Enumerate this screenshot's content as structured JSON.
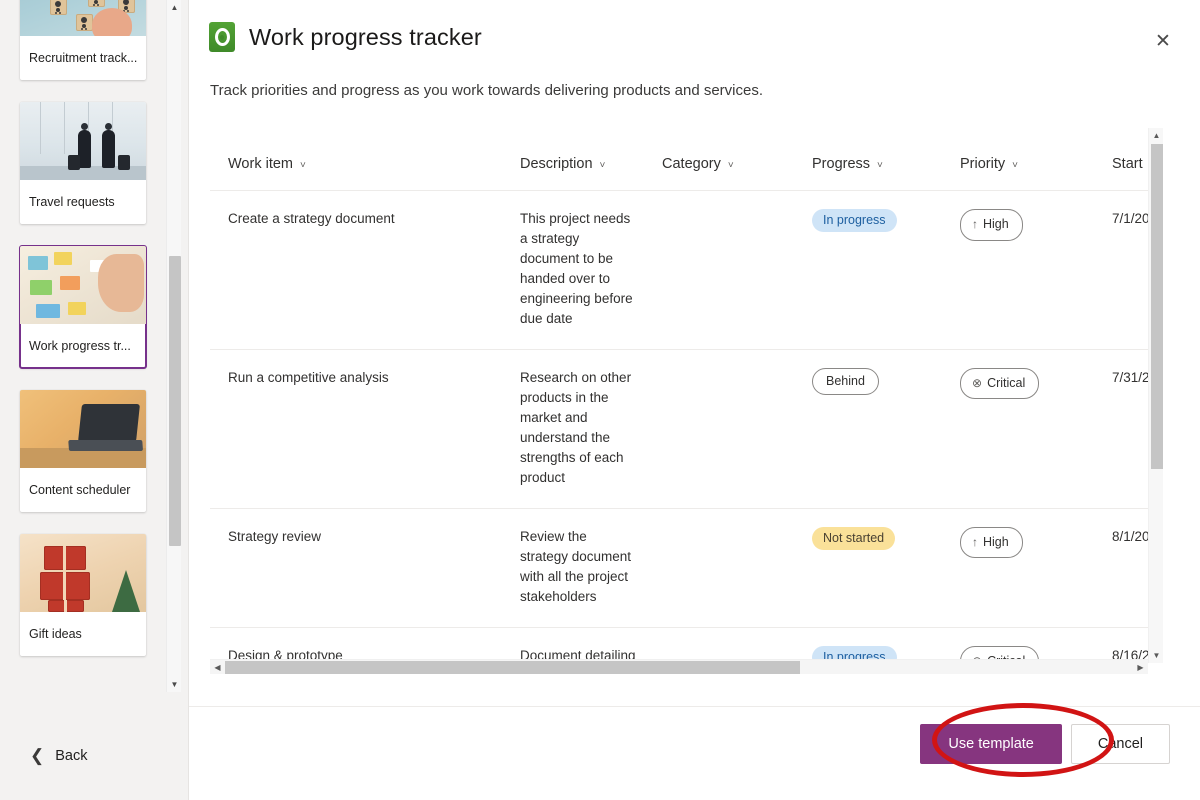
{
  "sidebar": {
    "templates": [
      {
        "label": "Recruitment track...",
        "thumb": "recruitment-people-blocks",
        "selected": false
      },
      {
        "label": "Travel requests",
        "thumb": "travel-airport-travellers",
        "selected": false
      },
      {
        "label": "Work progress tr...",
        "thumb": "work-progress-sticky-notes",
        "selected": true
      },
      {
        "label": "Content scheduler",
        "thumb": "content-person-laptop",
        "selected": false
      },
      {
        "label": "Gift ideas",
        "thumb": "gift-wrapped-presents",
        "selected": false
      }
    ],
    "back_label": "Back",
    "back_icon": "chevron-left-icon",
    "scrollbar": {
      "up_icon": "caret-up-icon",
      "down_icon": "caret-down-icon"
    }
  },
  "dialog": {
    "app_icon": "microsoft-lists-icon",
    "title": "Work progress tracker",
    "subtitle": "Track priorities and progress as you work towards delivering products and services.",
    "close_icon": "close-icon",
    "accent_color": "#86357f",
    "selected_border_color": "#76318b"
  },
  "table": {
    "sort_icon": "chevron-down-icon",
    "columns": [
      {
        "key": "work_item",
        "label": "Work item"
      },
      {
        "key": "description",
        "label": "Description"
      },
      {
        "key": "category",
        "label": "Category"
      },
      {
        "key": "progress",
        "label": "Progress"
      },
      {
        "key": "priority",
        "label": "Priority"
      },
      {
        "key": "start_date",
        "label": "Start "
      }
    ],
    "rows": [
      {
        "work_item": "Create a strategy document",
        "description": "This project needs a strategy document to be handed over to engineering before due date",
        "category": "",
        "progress": "In progress",
        "progress_style": "blue",
        "priority": "High",
        "priority_glyph": "↑",
        "priority_icon": "arrow-up-icon",
        "start_date": "7/1/20"
      },
      {
        "work_item": "Run a competitive analysis",
        "description": "Research on other products in the market and understand the strengths of each product",
        "category": "",
        "progress": "Behind",
        "progress_style": "grey",
        "priority": "Critical",
        "priority_glyph": "⊗",
        "priority_icon": "circle-x-icon",
        "start_date": "7/31/2"
      },
      {
        "work_item": "Strategy review",
        "description": "Review the strategy document with all the project stakeholders",
        "category": "",
        "progress": "Not started",
        "progress_style": "yellow",
        "priority": "High",
        "priority_glyph": "↑",
        "priority_icon": "arrow-up-icon",
        "start_date": "8/1/20"
      },
      {
        "work_item": "Design & prototype",
        "description": "Document detailing the scope, scale, and core details of the project from a design perspective",
        "category": "",
        "progress": "In progress",
        "progress_style": "blue",
        "priority": "Critical",
        "priority_glyph": "⊗",
        "priority_icon": "circle-x-icon",
        "start_date": "8/16/2"
      }
    ],
    "scrollbars": {
      "v_up_icon": "caret-up-icon",
      "v_down_icon": "caret-down-icon",
      "h_left_icon": "caret-left-icon",
      "h_right_icon": "caret-right-icon"
    }
  },
  "footer": {
    "primary_label": "Use template",
    "secondary_label": "Cancel"
  },
  "badge_colors": {
    "in_progress_bg": "#cfe4f7",
    "in_progress_fg": "#1d5fa0",
    "not_started_bg": "#fae199",
    "not_started_fg": "#494132",
    "behind_border": "#8a8886"
  },
  "annotation": {
    "shape": "red-ellipse-highlight",
    "color": "#d11414",
    "target": "Use template"
  }
}
